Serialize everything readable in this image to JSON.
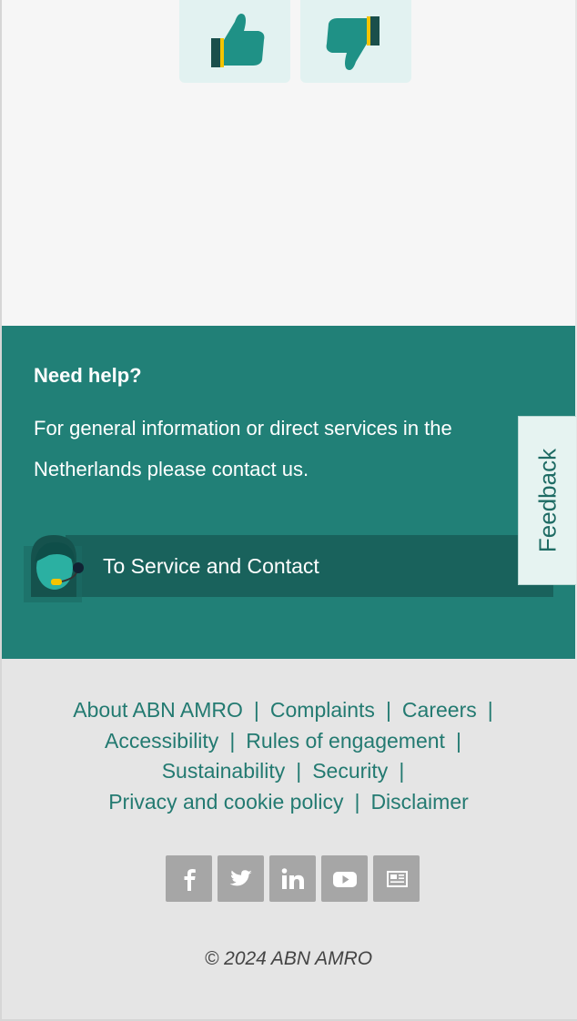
{
  "help": {
    "title": "Need help?",
    "text": "For general information or direct services in the Netherlands please contact us.",
    "service_button": "To Service and Contact"
  },
  "feedback": {
    "label": "Feedback"
  },
  "footer": {
    "links": [
      [
        "About ABN AMRO",
        "Complaints",
        "Careers"
      ],
      [
        "Accessibility",
        "Rules of engagement"
      ],
      [
        "Sustainability",
        "Security"
      ],
      [
        "Privacy and cookie policy",
        "Disclaimer"
      ]
    ],
    "social_icons": [
      "facebook-icon",
      "twitter-icon",
      "linkedin-icon",
      "youtube-icon",
      "newsletter-icon"
    ],
    "copyright": "© 2024 ABN AMRO"
  },
  "colors": {
    "primary": "#218077",
    "dark": "#19625c",
    "link": "#237a71",
    "accent": "#f5c400"
  }
}
